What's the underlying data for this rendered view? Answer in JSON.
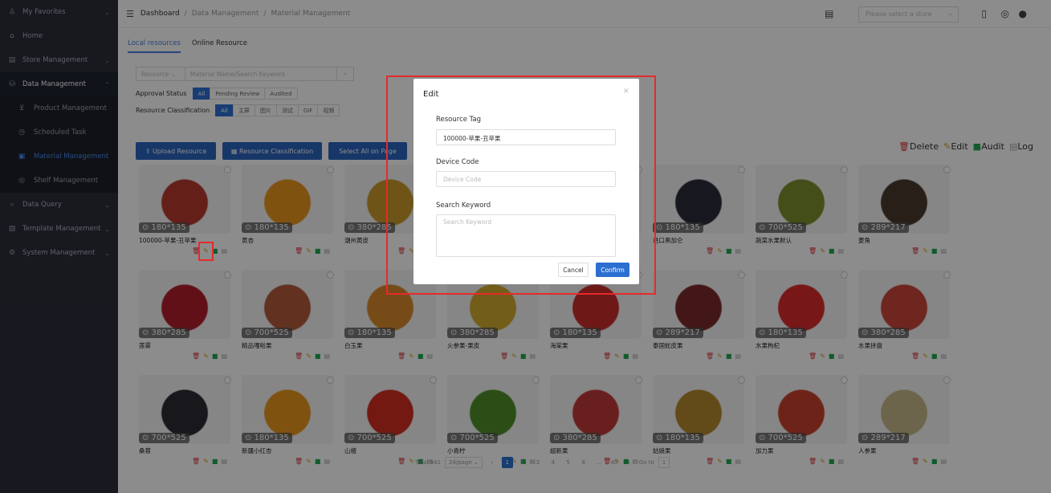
{
  "sidebar": {
    "items": [
      {
        "label": "My Favorites",
        "icon": "user-icon",
        "chevron": "⌄"
      },
      {
        "label": "Home",
        "icon": "home-icon"
      },
      {
        "label": "Store Management",
        "icon": "store-icon",
        "chevron": "⌄"
      },
      {
        "label": "Data Management",
        "icon": "database-icon",
        "chevron": "⌃"
      }
    ],
    "sub_items": [
      {
        "label": "Product Management",
        "icon": "cart-icon"
      },
      {
        "label": "Scheduled Task",
        "icon": "clock-icon"
      },
      {
        "label": "Material Management",
        "icon": "image-icon"
      },
      {
        "label": "Shelf Management",
        "icon": "shelf-icon"
      }
    ],
    "items_after": [
      {
        "label": "Data Query",
        "icon": "search-icon",
        "chevron": "⌄"
      },
      {
        "label": "Template Management",
        "icon": "template-icon",
        "chevron": "⌄"
      },
      {
        "label": "System Management",
        "icon": "gear-icon",
        "chevron": "⌄"
      }
    ]
  },
  "breadcrumb": {
    "first": "Dashboard",
    "sep": "/",
    "second": "Data Management",
    "third": "Material Management"
  },
  "header": {
    "store_placeholder": "Please select a store"
  },
  "tabs": [
    "Local resources",
    "Online Resource"
  ],
  "search": {
    "type_label": "Resource",
    "placeholder": "Material Name/Search Keyword"
  },
  "filters": {
    "approval_label": "Approval Status",
    "approval_options": [
      "All",
      "Pending Review",
      "Audited"
    ],
    "class_label": "Resource Classification",
    "class_options": [
      "All",
      "主屏",
      "图片",
      "测试",
      "GIF",
      "视频"
    ]
  },
  "actions": {
    "upload": "Upload Resource",
    "classify": "Resource Classification",
    "select_all": "Select All on Page"
  },
  "right_actions": {
    "delete": "Delete",
    "edit": "Edit",
    "audit": "Audit",
    "log": "Log"
  },
  "cards": [
    {
      "name": "100000-苹果-丑苹果",
      "dim": "180*135",
      "color": "#b83a2e"
    },
    {
      "name": "黄杏",
      "dim": "180*135",
      "color": "#e8951e"
    },
    {
      "name": "潮州黄皮",
      "dim": "380*285",
      "color": "#c99a2b"
    },
    {
      "name": "",
      "dim": "",
      "color": "#ddd"
    },
    {
      "name": "",
      "dim": "",
      "color": "#ddd"
    },
    {
      "name": "进口黑加仑",
      "dim": "180*135",
      "color": "#2b2a3a"
    },
    {
      "name": "蔬菜水果默认",
      "dim": "700*525",
      "color": "#7a8f2d"
    },
    {
      "name": "菱角",
      "dim": "289*217",
      "color": "#4b3a2e"
    },
    {
      "name": "莲雾",
      "dim": "380*285",
      "color": "#b21e2a"
    },
    {
      "name": "精品嘎啦果",
      "dim": "700*525",
      "color": "#b25a3b"
    },
    {
      "name": "白玉果",
      "dim": "180*135",
      "color": "#d9892c"
    },
    {
      "name": "火参果-果皮",
      "dim": "380*285",
      "color": "#cfa92e"
    },
    {
      "name": "海棠果",
      "dim": "180*135",
      "color": "#c82d2d"
    },
    {
      "name": "泰国蛇皮果",
      "dim": "289*217",
      "color": "#7a2b2b"
    },
    {
      "name": "水果枸杞",
      "dim": "180*135",
      "color": "#d92a2a"
    },
    {
      "name": "水果拼盘",
      "dim": "380*285",
      "color": "#c9463a"
    },
    {
      "name": "桑葚",
      "dim": "700*525",
      "color": "#2b2a33"
    },
    {
      "name": "新疆小红杏",
      "dim": "180*135",
      "color": "#e8951e"
    },
    {
      "name": "山楂",
      "dim": "700*525",
      "color": "#d12e22"
    },
    {
      "name": "小青柠",
      "dim": "700*525",
      "color": "#4f8f2b"
    },
    {
      "name": "超新果",
      "dim": "380*285",
      "color": "#c23a3a"
    },
    {
      "name": "姑娘果",
      "dim": "180*135",
      "color": "#b2882e"
    },
    {
      "name": "加力果",
      "dim": "700*525",
      "color": "#c8402e"
    },
    {
      "name": "人参果",
      "dim": "289*217",
      "color": "#c5b98a"
    }
  ],
  "pager": {
    "total": "Total 941",
    "size": "24/page",
    "pages": [
      "1",
      "2",
      "3",
      "4",
      "5",
      "6",
      "...",
      "40"
    ],
    "goto": "Go to",
    "goto_value": "1"
  },
  "modal": {
    "title": "Edit",
    "close": "×",
    "tag_label": "Resource Tag",
    "tag_value": "100000-苹果-丑苹果",
    "device_label": "Device Code",
    "device_placeholder": "Device Code",
    "keyword_label": "Search Keyword",
    "keyword_placeholder": "Search Keyword",
    "cancel": "Cancel",
    "confirm": "Confirm"
  }
}
